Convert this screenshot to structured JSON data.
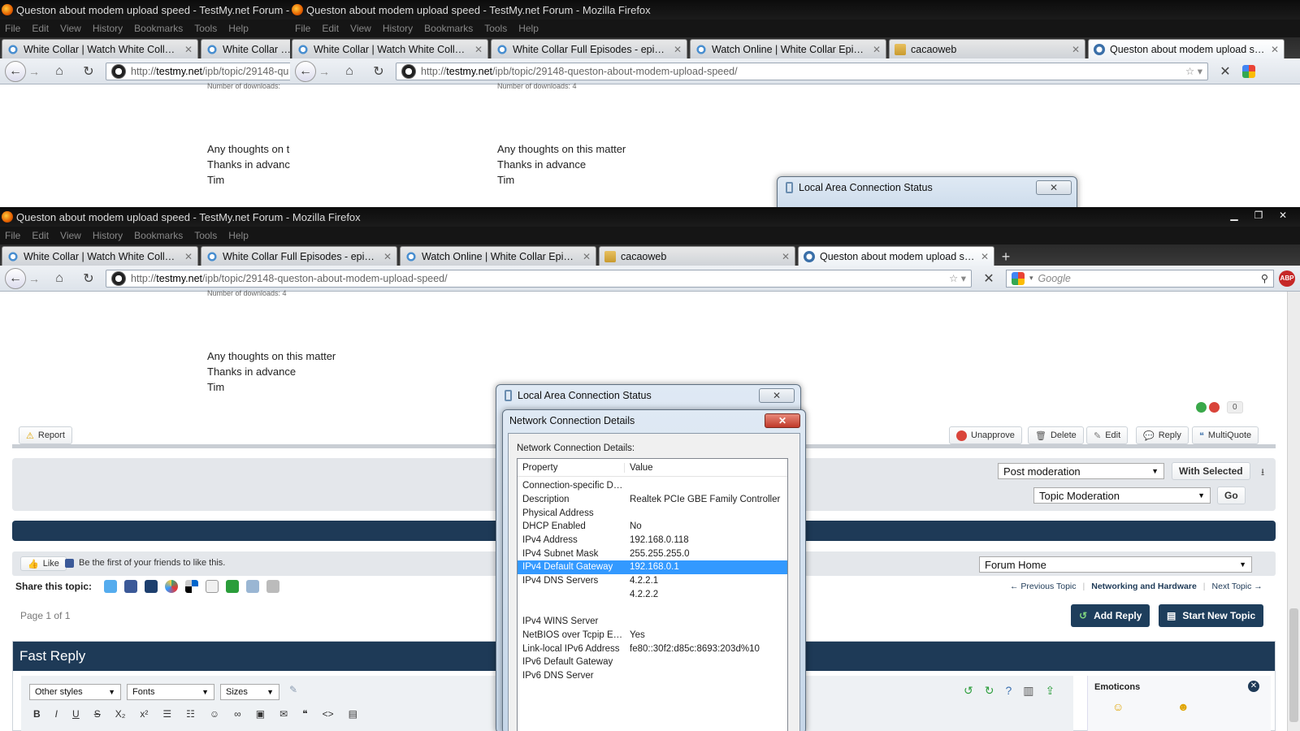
{
  "window_title": "Queston about modem upload speed - TestMy.net Forum - Mozilla Firefox",
  "window_title_short": "Queston about modem upload speed - TestMy.net Forum - Moz",
  "menu": [
    "File",
    "Edit",
    "View",
    "History",
    "Bookmarks",
    "Tools",
    "Help"
  ],
  "tabs_back": [
    {
      "label": "White Collar | Watch White Collar onl...",
      "icon": "gear-icon"
    },
    {
      "label": "White Collar Full",
      "icon": "gear-icon"
    }
  ],
  "tabs_mid": [
    {
      "label": "White Collar | Watch White Collar onl...",
      "icon": "gear-icon"
    },
    {
      "label": "White Collar Full Episodes - episode ...",
      "icon": "gear-icon"
    },
    {
      "label": "Watch Online | White Collar Episodes...",
      "icon": "gear-icon"
    },
    {
      "label": "cacaoweb",
      "icon": "folder-icon"
    },
    {
      "label": "Queston about modem upload spee...",
      "icon": "testmy-icon"
    }
  ],
  "tabs_front": [
    {
      "label": "White Collar | Watch White Collar onl...",
      "icon": "gear-icon"
    },
    {
      "label": "White Collar Full Episodes - episode ...",
      "icon": "gear-icon"
    },
    {
      "label": "Watch Online | White Collar Episodes...",
      "icon": "gear-icon"
    },
    {
      "label": "cacaoweb",
      "icon": "folder-icon"
    },
    {
      "label": "Queston about modem upload spee...",
      "icon": "testmy-icon"
    }
  ],
  "url": {
    "prefix": "http://",
    "host": "testmy.net",
    "path": "/ipb/topic/29148-queston-about-modem-upload-speed/",
    "path_cut": "/ipb/topic/29148-qu"
  },
  "search": {
    "placeholder": "Google"
  },
  "post": {
    "downloads_label": "Number of downloads:",
    "downloads_full": "Number of downloads: 4",
    "line1": "Any thoughts on this matter",
    "line1_cut": "Any thoughts on th",
    "line2": "Thanks in advance",
    "line2_cut": "Thanks in advanc",
    "line3": "Tim",
    "rep_count": "0"
  },
  "post_actions": {
    "report": "Report",
    "unapprove": "Unapprove",
    "delete": "Delete",
    "edit": "Edit",
    "reply": "Reply",
    "multiquote": "MultiQuote"
  },
  "moderation": {
    "post_select": "Post moderation",
    "with_selected": "With Selected",
    "topic_select": "Topic Moderation",
    "go": "Go"
  },
  "social": {
    "like": "Like",
    "be_first": "Be the first of your friends to like this.",
    "share_label": "Share this topic:",
    "share_icons": [
      "twitter-icon",
      "facebook-icon",
      "digg-icon",
      "delicious-icon",
      "stumble-icon",
      "reddit-icon",
      "email-icon",
      "print-icon",
      "download-icon"
    ]
  },
  "jump": {
    "select": "Forum Home"
  },
  "topic_nav": {
    "prev": "← Previous Topic",
    "forum": "Networking and Hardware",
    "next": "Next Topic →"
  },
  "pager": "Page 1 of 1",
  "buttons": {
    "add_reply": "Add Reply",
    "start_topic": "Start New Topic"
  },
  "fast_reply": {
    "title": "Fast Reply",
    "styles": "Other styles",
    "fonts": "Fonts",
    "sizes": "Sizes",
    "emoticons": "Emoticons"
  },
  "dialog_status": {
    "title": "Local Area Connection Status"
  },
  "dialog_details": {
    "title": "Network Connection Details",
    "label": "Network Connection Details:",
    "col_property": "Property",
    "col_value": "Value",
    "rows": [
      {
        "p": "Connection-specific DN...",
        "v": ""
      },
      {
        "p": "Description",
        "v": "Realtek PCIe GBE Family Controller"
      },
      {
        "p": "Physical Address",
        "v": ""
      },
      {
        "p": "DHCP Enabled",
        "v": "No"
      },
      {
        "p": "IPv4 Address",
        "v": "192.168.0.118"
      },
      {
        "p": "IPv4 Subnet Mask",
        "v": "255.255.255.0"
      },
      {
        "p": "IPv4 Default Gateway",
        "v": "192.168.0.1"
      },
      {
        "p": "IPv4 DNS Servers",
        "v": "4.2.2.1"
      },
      {
        "p": "",
        "v": "4.2.2.2"
      },
      {
        "p": "",
        "v": ""
      },
      {
        "p": "IPv4 WINS Server",
        "v": ""
      },
      {
        "p": "NetBIOS over Tcpip En...",
        "v": "Yes"
      },
      {
        "p": "Link-local IPv6 Address",
        "v": "fe80::30f2:d85c:8693:203d%10"
      },
      {
        "p": "IPv6 Default Gateway",
        "v": ""
      },
      {
        "p": "IPv6 DNS Server",
        "v": ""
      }
    ],
    "selected_row": 6
  },
  "colors": {
    "navy": "#1e3a57",
    "selection": "#3399ff",
    "close_red": "#c0392b"
  }
}
